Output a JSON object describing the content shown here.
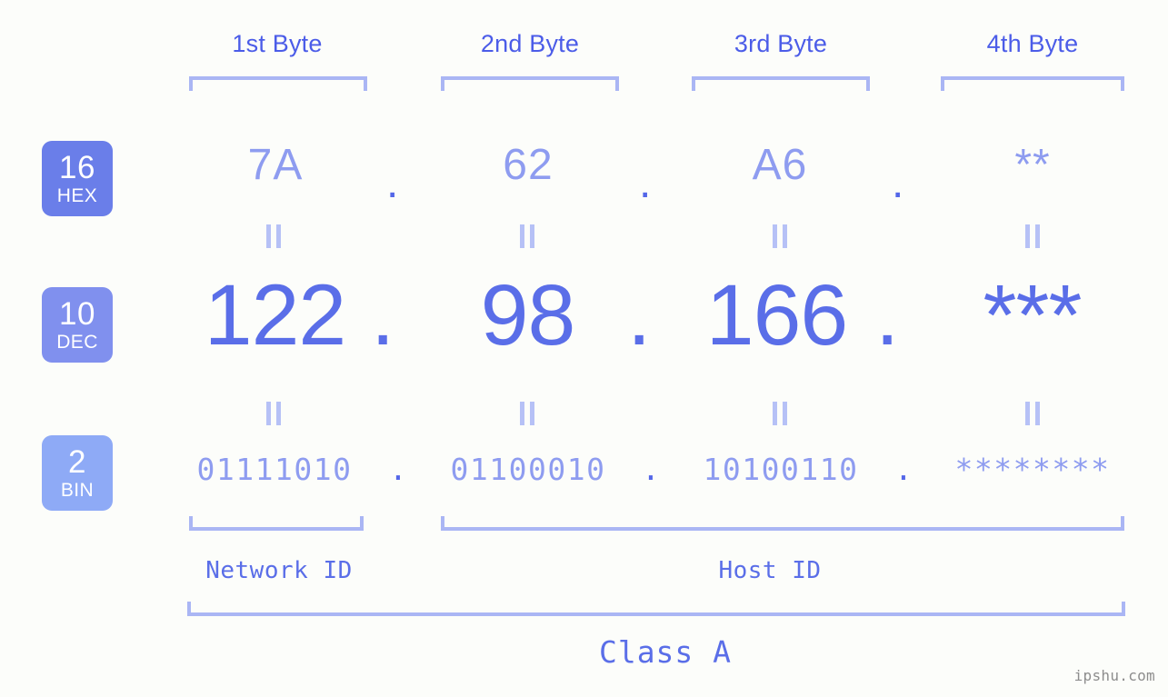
{
  "background_color": "#fcfdfa",
  "accent_colors": {
    "header_text": "#4b5ce8",
    "bracket": "#aab6f4",
    "hex_value": "#8e9cf0",
    "dec_value": "#5a6ee8",
    "bin_value": "#8e9cf0",
    "dot": "#5467e8",
    "badge_hex": "#6a7ee9",
    "badge_dec": "#8090ee",
    "badge_bin": "#8eaaf6",
    "equals_mark": "#b6c1f6",
    "watermark": "#8d8d8d"
  },
  "byte_headers": [
    {
      "label": "1st Byte"
    },
    {
      "label": "2nd Byte"
    },
    {
      "label": "3rd Byte"
    },
    {
      "label": "4th Byte"
    }
  ],
  "radix_badges": [
    {
      "number": "16",
      "name": "HEX"
    },
    {
      "number": "10",
      "name": "DEC"
    },
    {
      "number": "2",
      "name": "BIN"
    }
  ],
  "rows": {
    "hex": {
      "values": [
        "7A",
        "62",
        "A6",
        "**"
      ],
      "separator": "."
    },
    "dec": {
      "values": [
        "122",
        "98",
        "166",
        "***"
      ],
      "separator": "."
    },
    "bin": {
      "values": [
        "01111010",
        "01100010",
        "10100110",
        "********"
      ],
      "separator": "."
    }
  },
  "equals_symbol": "||",
  "regions": [
    {
      "label": "Network ID"
    },
    {
      "label": "Host ID"
    }
  ],
  "class_label": "Class A",
  "watermark": "ipshu.com"
}
